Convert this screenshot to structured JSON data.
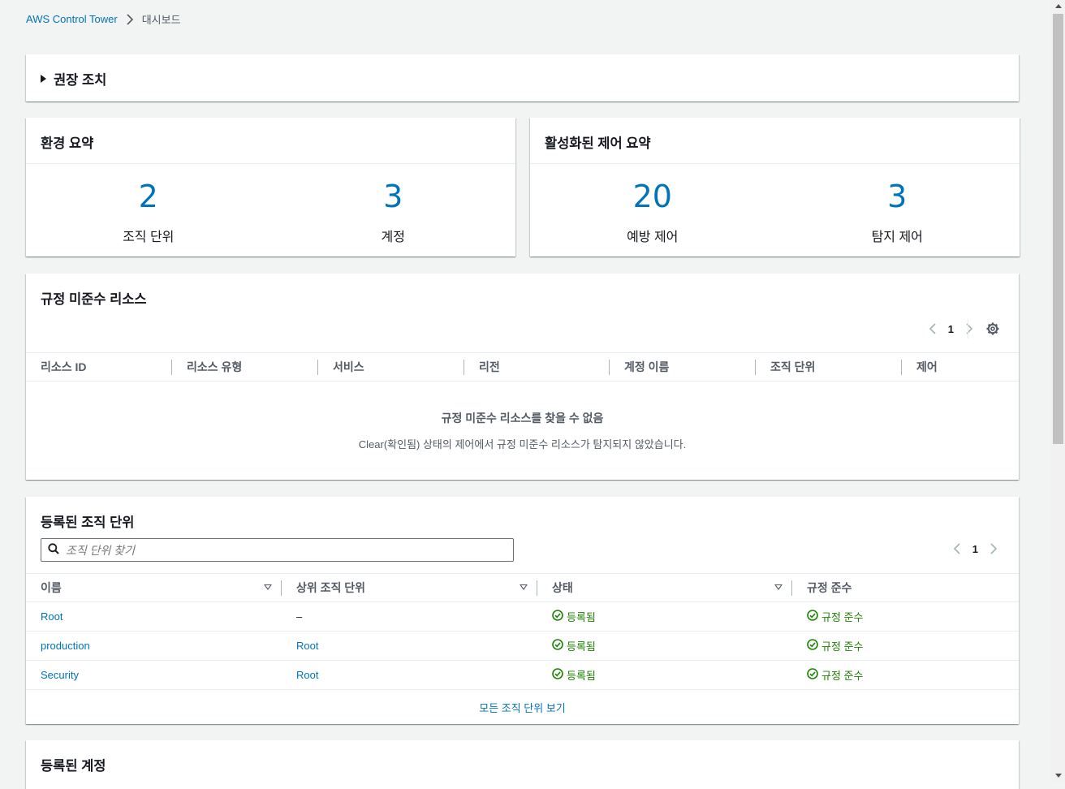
{
  "breadcrumb": {
    "root": "AWS Control Tower",
    "current": "대시보드"
  },
  "recommended": {
    "label": "권장 조치"
  },
  "env_summary": {
    "title": "환경 요약",
    "stats": [
      {
        "value": "2",
        "label": "조직 단위"
      },
      {
        "value": "3",
        "label": "계정"
      }
    ]
  },
  "controls_summary": {
    "title": "활성화된 제어 요약",
    "stats": [
      {
        "value": "20",
        "label": "예방 제어"
      },
      {
        "value": "3",
        "label": "탐지 제어"
      }
    ]
  },
  "noncompliant": {
    "title": "규정 미준수 리소스",
    "page": "1",
    "columns": [
      "리소스 ID",
      "리소스 유형",
      "서비스",
      "리전",
      "계정 이름",
      "조직 단위",
      "제어"
    ],
    "empty_title": "규정 미준수 리소스를 찾을 수 없음",
    "empty_desc": "Clear(확인됨) 상태의 제어에서 규정 미준수 리소스가 탐지되지 않았습니다."
  },
  "ou": {
    "title": "등록된 조직 단위",
    "search_placeholder": "조직 단위 찾기",
    "page": "1",
    "columns": [
      "이름",
      "상위 조직 단위",
      "상태",
      "규정 준수"
    ],
    "rows": [
      {
        "name": "Root",
        "parent": "–",
        "status": "등록됨",
        "compliance": "규정 준수"
      },
      {
        "name": "production",
        "parent": "Root",
        "status": "등록됨",
        "compliance": "규정 준수"
      },
      {
        "name": "Security",
        "parent": "Root",
        "status": "등록됨",
        "compliance": "규정 준수"
      }
    ],
    "view_all": "모든 조직 단위 보기"
  },
  "accounts": {
    "title": "등록된 계정"
  },
  "colors": {
    "link": "#0073bb",
    "success": "#1d8102",
    "text": "#16191f",
    "muted": "#545b64",
    "background": "#f2f3f3"
  }
}
